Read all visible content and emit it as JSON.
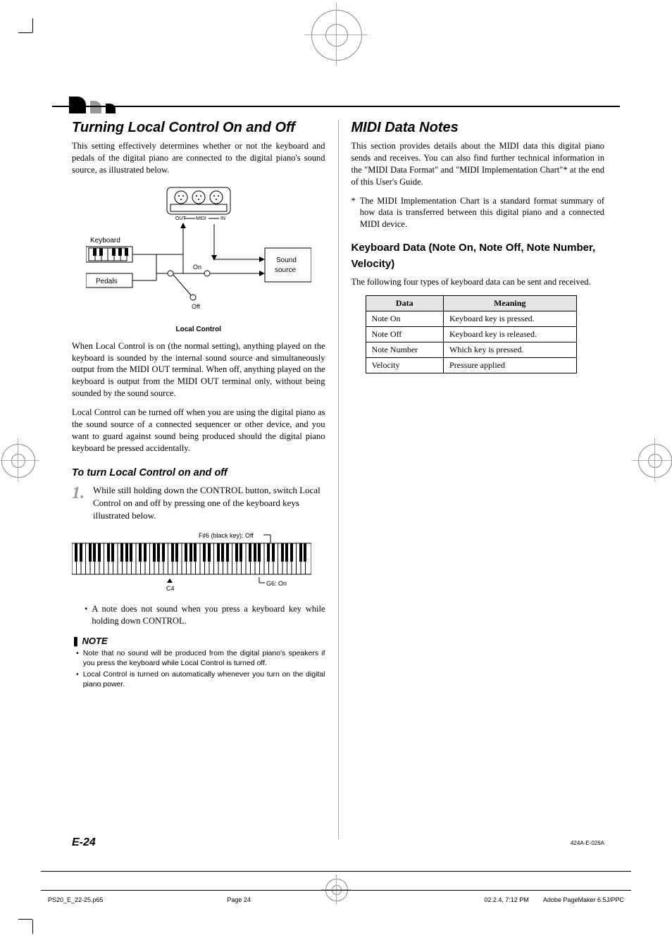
{
  "left": {
    "title": "Turning Local Control On and Off",
    "intro": "This setting effectively determines whether or not the keyboard and pedals of the digital piano are connected to the digital piano's sound source, as illustrated below.",
    "diagram": {
      "keyboard_label": "Keyboard",
      "pedals_label": "Pedals",
      "sound_source_line1": "Sound",
      "sound_source_line2": "source",
      "out_label": "OUT",
      "midi_label": "MIDI",
      "in_label": "IN",
      "on_label": "On",
      "off_label": "Off",
      "caption": "Local Control"
    },
    "para2": "When Local Control is on (the normal setting), anything played on the keyboard is sounded by the internal sound source and simultaneously output from the MIDI OUT terminal.  When off, anything played on the keyboard is output from the MIDI OUT terminal only, without being sounded by the sound source.",
    "para3": "Local Control can be turned off when you are using the digital piano as the sound source of a connected sequencer or other device, and you want to guard against sound being produced should the digital piano keyboard be pressed accidentally.",
    "subhead": "To turn Local Control on and off",
    "step_num": "1.",
    "step_text": "While still holding down the CONTROL button, switch Local Control on and off by pressing one of the keyboard keys illustrated below.",
    "kbd": {
      "off_label": "F♯6 (black key): Off",
      "c4_label": "C4",
      "on_label": "G6: On"
    },
    "bullet1": "A note does not sound when you press a keyboard key while holding down CONTROL.",
    "note_head": "NOTE",
    "note1": "Note that no sound will be produced from the digital piano's speakers if you press the keyboard while Local Control is turned off.",
    "note2": "Local Control is turned on automatically whenever you turn on the digital piano power."
  },
  "right": {
    "title": "MIDI Data Notes",
    "intro": "This section provides details about the MIDI data this digital piano sends and receives. You can also find further technical information in the \"MIDI Data Format\" and \"MIDI Implementation Chart\"* at the end of this User's Guide.",
    "footnote": "The MIDI Implementation Chart is a standard format summary of how data is transferred between this digital piano and a connected MIDI device.",
    "subhead": "Keyboard Data (Note On, Note Off, Note Number, Velocity)",
    "para": "The following four types of keyboard data can be sent and received.",
    "table": {
      "head_data": "Data",
      "head_meaning": "Meaning",
      "rows": [
        {
          "data": "Note On",
          "meaning": "Keyboard  key is pressed."
        },
        {
          "data": "Note Off",
          "meaning": "Keyboard key is released."
        },
        {
          "data": "Note Number",
          "meaning": "Which key is pressed."
        },
        {
          "data": "Velocity",
          "meaning": "Pressure applied"
        }
      ]
    }
  },
  "footer": {
    "page_number": "E-24",
    "doc_code": "424A-E-026A",
    "file": "PS20_E_22-25.p65",
    "page": "Page 24",
    "timestamp": "02.2.4, 7:12 PM",
    "app": "Adobe PageMaker 6.5J/PPC"
  }
}
